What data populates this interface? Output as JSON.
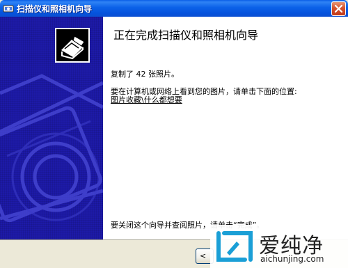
{
  "window": {
    "title": "扫描仪和照相机向导"
  },
  "content": {
    "heading": "正在完成扫描仪和照相机向导",
    "copied_message": "复制了 42 张照片。",
    "view_instruction": "要在计算机或网络上看到您的图片，请单击下面的位置:",
    "location_link": "图片收藏\\什么都想要",
    "close_instruction": "要关闭这个向导并查阅照片，请单击“完成”。"
  },
  "buttons": {
    "back_label": "< 上"
  },
  "watermark": {
    "brand": "爱纯净",
    "url": "aichunjing.com"
  },
  "colors": {
    "titlebar_blue": "#0b61e8",
    "left_panel_blue": "#1d1aa8",
    "close_button_red": "#c0391a",
    "dialog_gray": "#ece9d8"
  },
  "icons": {
    "title": "scanner-camera-wizard-icon",
    "wizard": "scanner-wizard-icon",
    "close": "close-icon"
  }
}
